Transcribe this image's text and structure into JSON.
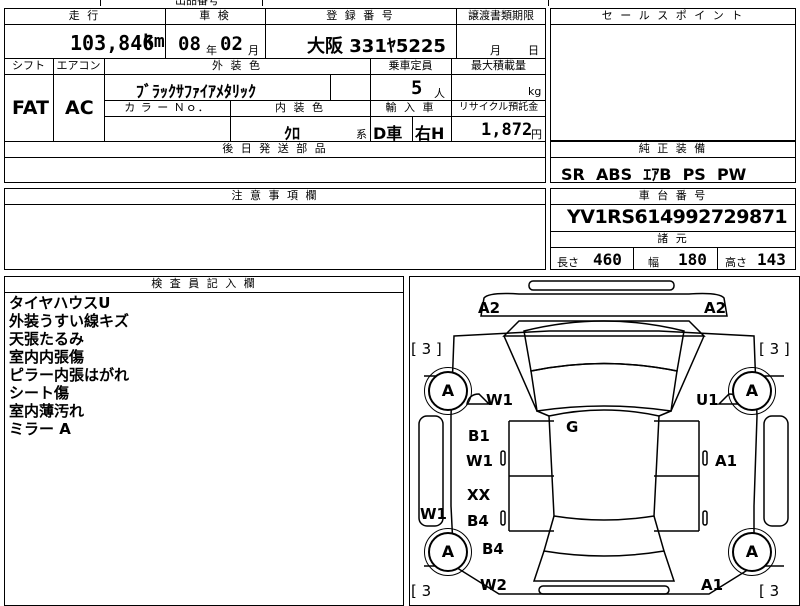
{
  "top_strip": {
    "partial_text": "出品番号"
  },
  "row1": {
    "headers": {
      "mileage": "走 行",
      "inspection": "車 検",
      "registration": "登 録 番 号",
      "transfer": "譲渡書類期限"
    },
    "mileage_value": "103,846",
    "mileage_unit": "km",
    "inspection_year": "08",
    "inspection_year_unit": "年",
    "inspection_month": "02",
    "inspection_month_unit": "月",
    "registration_value": "大阪 331ﾔ5225",
    "transfer_month_unit": "月",
    "transfer_day_unit": "日"
  },
  "row2": {
    "headers": {
      "shift": "シフト",
      "aircon": "エアコン",
      "exterior_color": "外 装 色",
      "capacity": "乗車定員",
      "max_load": "最大積載量"
    },
    "shift_value": "FAT",
    "aircon_value": "AC",
    "exterior_color_value": "ﾌﾞﾗｯｸｻﾌｧｲｱﾒﾀﾘｯｸ",
    "capacity_value": "5",
    "capacity_unit": "人",
    "max_load_unit": "kg"
  },
  "row3": {
    "headers": {
      "color_no": "カ ラ ー Ｎｏ．",
      "interior_color": "内 装 色",
      "import": "輸 入 車",
      "recycle": "リサイクル預託金"
    },
    "interior_color_value": "ｸﾛ",
    "interior_color_unit": "系",
    "import_d": "D車",
    "import_h": "右H",
    "recycle_value": "1,872",
    "recycle_unit": "円"
  },
  "later_parts": {
    "header": "後 日 発 送 部 品"
  },
  "sales_point": {
    "header": "セ ー ル ス ポ イ ン ト"
  },
  "standard_equipment": {
    "header": "純 正 装 備",
    "value": "SR  ABS  ｴｱB  PS  PW"
  },
  "caution": {
    "header": "注 意 事 項 欄"
  },
  "chassis": {
    "header": "車 台 番 号",
    "value": "YV1RS614992729871"
  },
  "specs": {
    "header": "諸 元",
    "length_label": "長さ",
    "length_value": "460",
    "width_label": "幅",
    "width_value": "180",
    "height_label": "高さ",
    "height_value": "143"
  },
  "inspector": {
    "header": "検 査 員 記 入 欄",
    "notes": [
      "タイヤハウスU",
      "外装うすい線キズ",
      "天張たるみ",
      "室内内張傷",
      "ピラー内張はがれ",
      "シート傷",
      "室内薄汚れ",
      "ミラー A"
    ]
  },
  "diagram": {
    "front_left_corner": "A2",
    "front_right_corner": "A2",
    "tire_fl_bracket": "[ 3 ]",
    "tire_fr_bracket": "[ 3 ]",
    "tire_rl_bracket": "[ 3",
    "tire_rr_bracket": "[ 3",
    "wheel_fl": "A",
    "wheel_fr": "A",
    "wheel_rl": "A",
    "wheel_rr": "A",
    "front_left_fender": "W1",
    "front_right_fender": "U1",
    "roof": "G",
    "left_front_door_top": "B1",
    "left_front_door_bottom": "W1",
    "right_front_door": "A1",
    "left_rear_door_top": "XX",
    "left_rear_door_bottom": "B4",
    "left_sill": "W1",
    "left_rear_fender": "B4",
    "rear_left": "W2",
    "rear_right": "A1"
  }
}
